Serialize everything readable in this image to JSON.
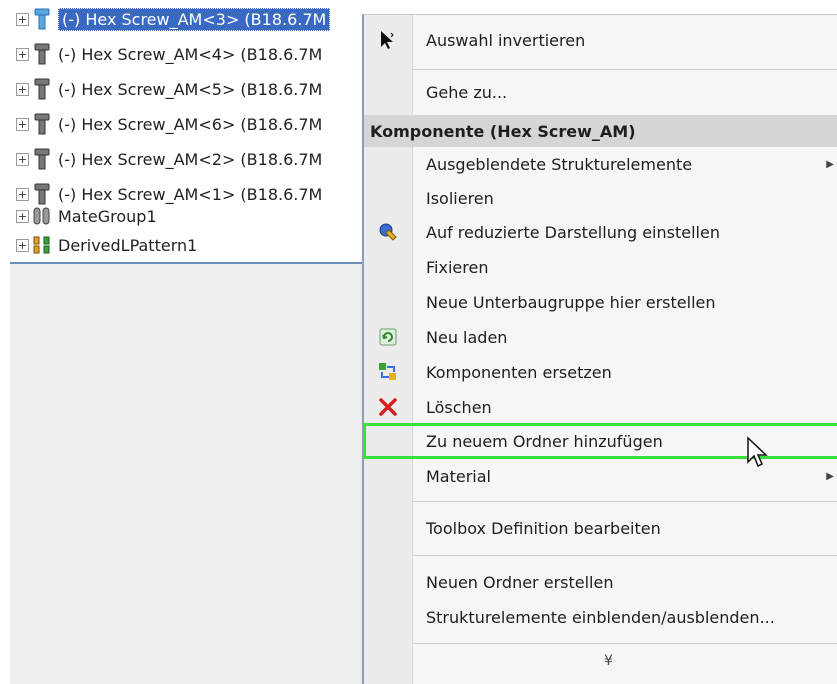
{
  "tree": {
    "items": [
      {
        "label": "(-) Hex Screw_AM<3> (B18.6.7M",
        "selected": true,
        "icon": "screw-icon"
      },
      {
        "label": "(-) Hex Screw_AM<4> (B18.6.7M",
        "icon": "screw-icon"
      },
      {
        "label": "(-) Hex Screw_AM<5> (B18.6.7M",
        "icon": "screw-icon"
      },
      {
        "label": "(-) Hex Screw_AM<6> (B18.6.7M",
        "icon": "screw-icon"
      },
      {
        "label": "(-) Hex Screw_AM<2> (B18.6.7M",
        "icon": "screw-icon"
      },
      {
        "label": "(-) Hex Screw_AM<1> (B18.6.7M",
        "icon": "screw-icon"
      },
      {
        "label": "MateGroup1",
        "icon": "mate-group-icon"
      },
      {
        "label": "DerivedLPattern1",
        "icon": "pattern-icon"
      }
    ],
    "expander_glyph": "+"
  },
  "menu": {
    "invert_selection": "Auswahl invertieren",
    "go_to": "Gehe zu...",
    "section_title": "Komponente (Hex Screw_AM)",
    "hidden_features": "Ausgeblendete Strukturelemente",
    "isolate": "Isolieren",
    "reduced_display": "Auf reduzierte Darstellung einstellen",
    "fix": "Fixieren",
    "new_subassembly": "Neue Unterbaugruppe hier erstellen",
    "reload": "Neu laden",
    "replace_components": "Komponenten ersetzen",
    "delete": "Löschen",
    "add_to_new_folder": "Zu neuem Ordner hinzufügen",
    "material": "Material",
    "toolbox_edit": "Toolbox Definition bearbeiten",
    "new_folder": "Neuen Ordner erstellen",
    "show_hide_features": "Strukturelemente einblenden/ausblenden...",
    "more_glyph": "¥"
  },
  "colors": {
    "selection": "#3969c2",
    "highlight_outline": "#39e039",
    "delete_icon": "#d42020"
  }
}
